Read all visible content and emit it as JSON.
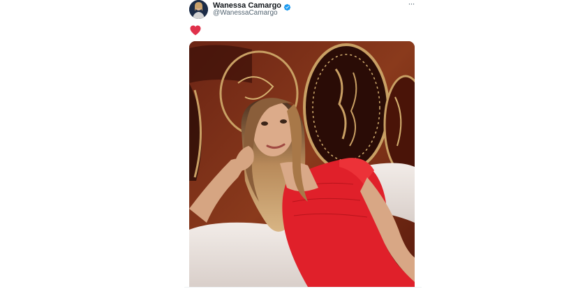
{
  "tweet": {
    "display_name": "Wanessa Camargo",
    "handle": "@WanessaCamargo",
    "more_label": "···",
    "body_emoji": "heart-emoji",
    "verified_icon": "verified-badge-icon",
    "verified_color": "#1d9bf0",
    "heart_color": "#e0314b",
    "media": {
      "description_icon": "photo",
      "background_color": "#5a1c10",
      "dress_color": "#e0202a",
      "pillow_color": "#ece4e0"
    }
  }
}
